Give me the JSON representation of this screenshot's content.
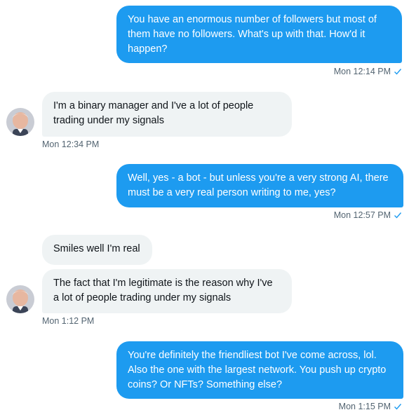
{
  "conversation": {
    "messages": [
      {
        "direction": "sent",
        "text": "You have an enormous number of followers but most of them have no followers. What's up with that. How'd it happen?",
        "timestamp": "Mon 12:14 PM"
      },
      {
        "direction": "received",
        "text": "I'm a binary manager and I've a lot of people trading under my signals",
        "timestamp": "Mon 12:34 PM"
      },
      {
        "direction": "sent",
        "text": "Well, yes - a bot - but unless you're a very strong AI, there must be a very real person writing to me, yes?",
        "timestamp": "Mon 12:57 PM"
      },
      {
        "direction": "received",
        "text": "Smiles well I'm real"
      },
      {
        "direction": "received",
        "text": "The fact that I'm legitimate is the reason why I've a lot of people trading under my signals",
        "timestamp": "Mon 1:12 PM"
      },
      {
        "direction": "sent",
        "text": "You're definitely the friendliest bot I've come across, lol. Also the one with the largest network. You push up crypto coins? Or NFTs? Something else?",
        "timestamp": "Mon 1:15 PM"
      }
    ]
  },
  "icons": {
    "read_receipt": "checkmark-icon",
    "avatar": "user-avatar"
  },
  "colors": {
    "sent_bubble": "#1d9bf0",
    "received_bubble": "#eff3f4",
    "timestamp": "#536471",
    "check": "#1d9bf0"
  }
}
